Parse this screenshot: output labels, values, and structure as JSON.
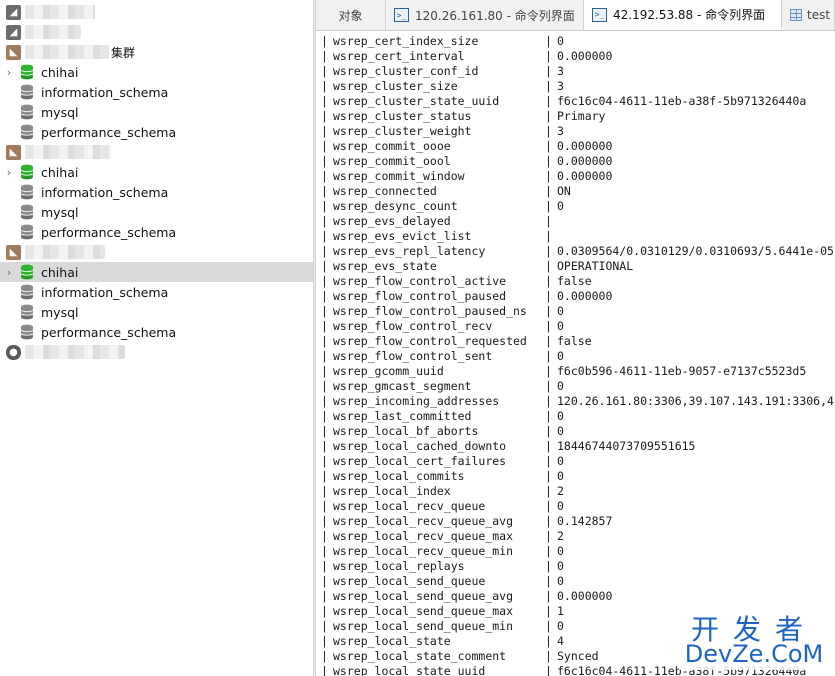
{
  "sidebar": {
    "connection_3_suffix": "集群",
    "databases": {
      "chihai": "chihai",
      "information_schema": "information_schema",
      "mysql": "mysql",
      "performance_schema": "performance_schema"
    }
  },
  "tabs": [
    {
      "label": "对象"
    },
    {
      "label": "120.26.161.80 - 命令列界面"
    },
    {
      "label": "42.192.53.88 - 命令列界面"
    },
    {
      "label": "test"
    }
  ],
  "results": {
    "rows": [
      {
        "name": "wsrep_cert_index_size",
        "value": "0"
      },
      {
        "name": "wsrep_cert_interval",
        "value": "0.000000"
      },
      {
        "name": "wsrep_cluster_conf_id",
        "value": "3"
      },
      {
        "name": "wsrep_cluster_size",
        "value": "3"
      },
      {
        "name": "wsrep_cluster_state_uuid",
        "value": "f6c16c04-4611-11eb-a38f-5b971326440a"
      },
      {
        "name": "wsrep_cluster_status",
        "value": "Primary"
      },
      {
        "name": "wsrep_cluster_weight",
        "value": "3"
      },
      {
        "name": "wsrep_commit_oooe",
        "value": "0.000000"
      },
      {
        "name": "wsrep_commit_oool",
        "value": "0.000000"
      },
      {
        "name": "wsrep_commit_window",
        "value": "0.000000"
      },
      {
        "name": "wsrep_connected",
        "value": "ON"
      },
      {
        "name": "wsrep_desync_count",
        "value": "0"
      },
      {
        "name": "wsrep_evs_delayed",
        "value": ""
      },
      {
        "name": "wsrep_evs_evict_list",
        "value": ""
      },
      {
        "name": "wsrep_evs_repl_latency",
        "value": "0.0309564/0.0310129/0.0310693/5.6441e-05"
      },
      {
        "name": "wsrep_evs_state",
        "value": "OPERATIONAL"
      },
      {
        "name": "wsrep_flow_control_active",
        "value": "false"
      },
      {
        "name": "wsrep_flow_control_paused",
        "value": "0.000000"
      },
      {
        "name": "wsrep_flow_control_paused_ns",
        "value": "0"
      },
      {
        "name": "wsrep_flow_control_recv",
        "value": "0"
      },
      {
        "name": "wsrep_flow_control_requested",
        "value": "false"
      },
      {
        "name": "wsrep_flow_control_sent",
        "value": "0"
      },
      {
        "name": "wsrep_gcomm_uuid",
        "value": "f6c0b596-4611-11eb-9057-e7137c5523d5"
      },
      {
        "name": "wsrep_gmcast_segment",
        "value": "0"
      },
      {
        "name": "wsrep_incoming_addresses",
        "value": "120.26.161.80:3306,39.107.143.191:3306,4"
      },
      {
        "name": "wsrep_last_committed",
        "value": "0"
      },
      {
        "name": "wsrep_local_bf_aborts",
        "value": "0"
      },
      {
        "name": "wsrep_local_cached_downto",
        "value": "18446744073709551615"
      },
      {
        "name": "wsrep_local_cert_failures",
        "value": "0"
      },
      {
        "name": "wsrep_local_commits",
        "value": "0"
      },
      {
        "name": "wsrep_local_index",
        "value": "2"
      },
      {
        "name": "wsrep_local_recv_queue",
        "value": "0"
      },
      {
        "name": "wsrep_local_recv_queue_avg",
        "value": "0.142857"
      },
      {
        "name": "wsrep_local_recv_queue_max",
        "value": "2"
      },
      {
        "name": "wsrep_local_recv_queue_min",
        "value": "0"
      },
      {
        "name": "wsrep_local_replays",
        "value": "0"
      },
      {
        "name": "wsrep_local_send_queue",
        "value": "0"
      },
      {
        "name": "wsrep_local_send_queue_avg",
        "value": "0.000000"
      },
      {
        "name": "wsrep_local_send_queue_max",
        "value": "1"
      },
      {
        "name": "wsrep_local_send_queue_min",
        "value": "0"
      },
      {
        "name": "wsrep_local_state",
        "value": "4"
      },
      {
        "name": "wsrep_local_state_comment",
        "value": "Synced"
      },
      {
        "name": "wsrep_local_state_uuid",
        "value": "f6c16c04-4611-11eb-a38f-5b971326440a"
      }
    ]
  },
  "watermark": {
    "line1": "开发者",
    "line2": "DevZe.CoM"
  },
  "colors": {
    "db_green": "#2db52d",
    "db_gray": "#8a8a8a",
    "selection": "#d9d9d9",
    "watermark": "#1f63c3"
  }
}
